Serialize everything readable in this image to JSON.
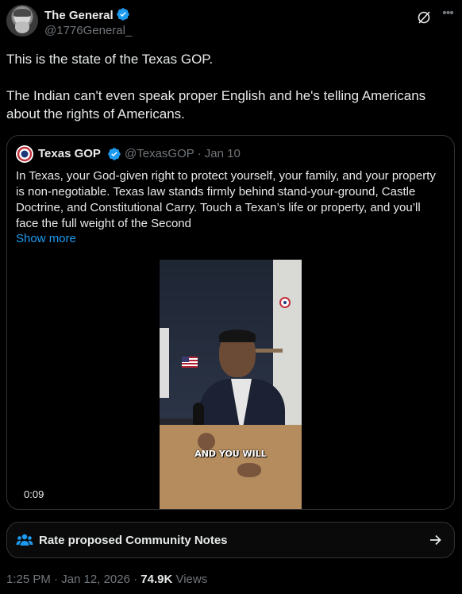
{
  "author": {
    "name": "The General",
    "handle": "@1776General_"
  },
  "tweet": {
    "paragraphs": [
      "This is the state of the Texas GOP.",
      "The Indian can't even speak proper English and he's telling Americans about the rights of Americans."
    ]
  },
  "quote": {
    "name": "Texas GOP",
    "handle_date": "@TexasGOP · Jan 10",
    "text": "In Texas, your God-given right to protect yourself, your family, and your property is non-negotiable. Texas law stands firmly behind stand-your-ground, Castle Doctrine, and Constitutional Carry. Touch a Texan’s life or property, and you’ll face the full weight of the Second",
    "show_more": "Show more",
    "video": {
      "caption": "AND YOU WILL",
      "duration": "0:09"
    }
  },
  "community_notes": {
    "label": "Rate proposed Community Notes"
  },
  "footer": {
    "timestamp": "1:25 PM · Jan 12, 2026 · ",
    "views_count": "74.9K",
    "views_label": " Views"
  },
  "colors": {
    "accent": "#1d9bf0",
    "background": "#000000",
    "text": "#e7e9ea",
    "muted": "#71767b"
  }
}
